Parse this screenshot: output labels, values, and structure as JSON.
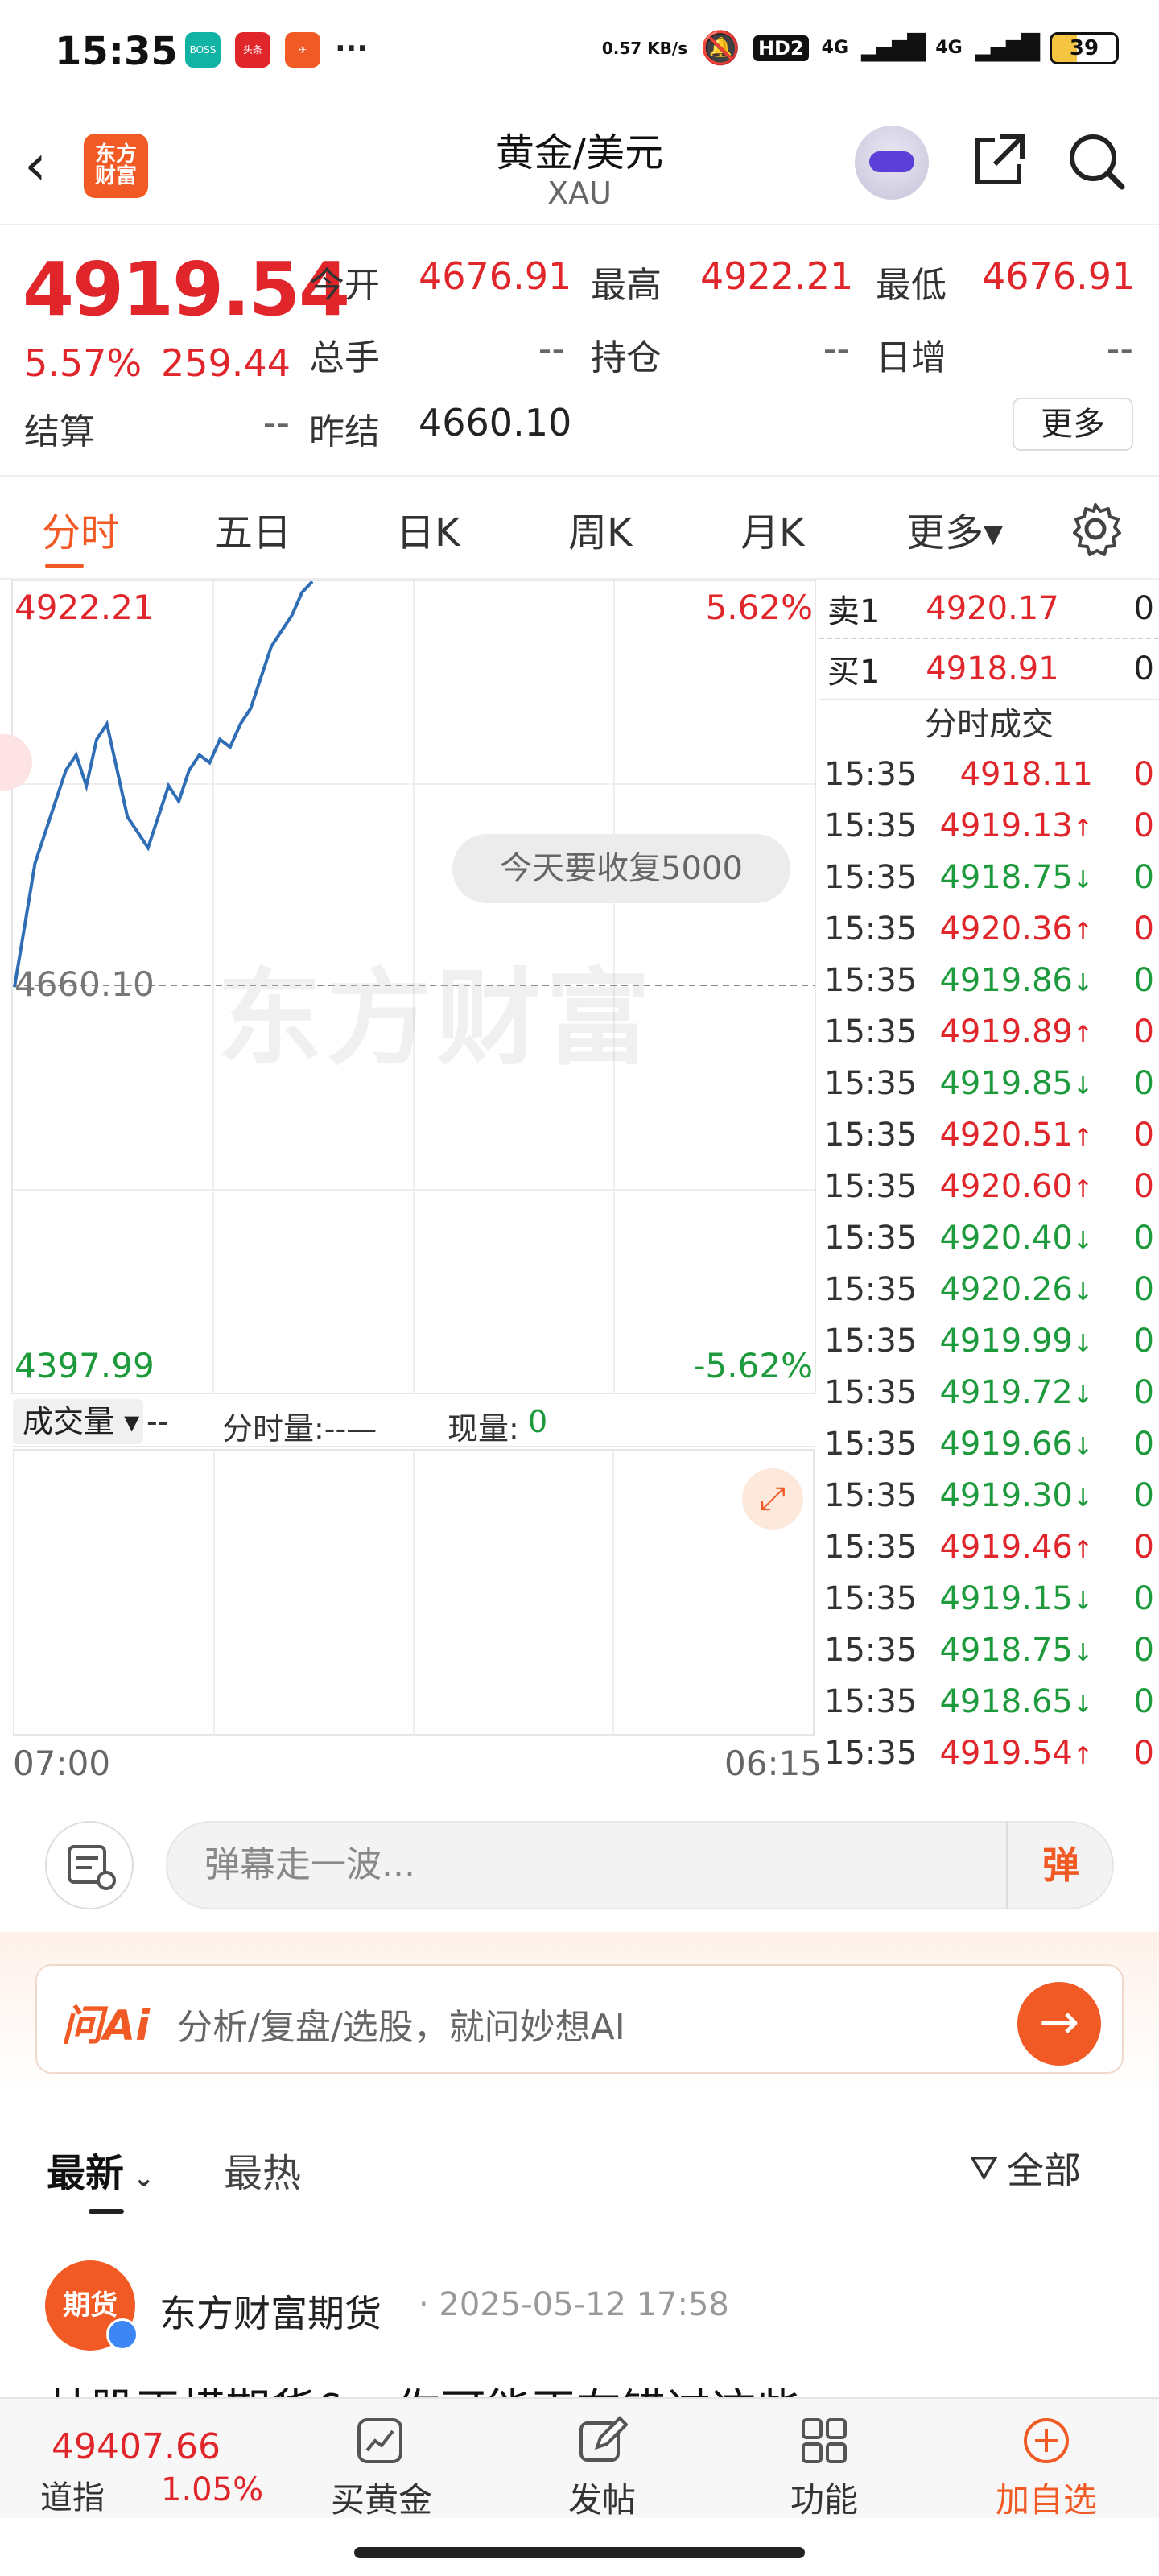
{
  "status_bar": {
    "time": "15:35",
    "apps": [
      "BOSS直聘",
      "头条",
      "消息"
    ],
    "more": "···",
    "net_speed": "0.57 KB/s",
    "hd": "HD2",
    "sig1": "4G",
    "sig2": "4G",
    "battery": "39"
  },
  "header": {
    "logo": "东方\n财富",
    "title": "黄金/美元",
    "subtitle": "XAU"
  },
  "quote": {
    "price": "4919.54",
    "change_pct": "5.57%",
    "change_val": "259.44",
    "open_label": "今开",
    "open": "4676.91",
    "high_label": "最高",
    "high": "4922.21",
    "low_label": "最低",
    "low": "4676.91",
    "volume_label": "总手",
    "volume": "--",
    "oi_label": "持仓",
    "oi": "--",
    "daily_inc_label": "日增",
    "daily_inc": "--",
    "settle_label": "结算",
    "settle": "--",
    "prev_settle_label": "昨结",
    "prev_settle": "4660.10",
    "more": "更多"
  },
  "tabs": [
    "分时",
    "五日",
    "日K",
    "周K",
    "月K",
    "更多▾"
  ],
  "chart": {
    "top_price": "4922.21",
    "top_pct": "5.62%",
    "mid_price": "4660.10",
    "bottom_price": "4397.99",
    "bottom_pct": "-5.62%",
    "bubble": "今天要收复5000",
    "watermark": "东方财富",
    "vol_label": "成交量 ▾",
    "vol_dash": "--",
    "intraday_vol": "分时量:--—",
    "now_vol_label": "现量:",
    "now_vol": "0",
    "start_time": "07:00",
    "end_time": "06:15"
  },
  "chart_data": {
    "type": "line",
    "series": [
      {
        "values": [
          4660,
          4700,
          4740,
          4760,
          4780,
          4800,
          4810,
          4790,
          4820,
          4830,
          4800,
          4770,
          4760,
          4750,
          4770,
          4790,
          4780,
          4800,
          4810,
          4805,
          4820,
          4815,
          4830,
          4840,
          4860,
          4880,
          4890,
          4900,
          4915,
          4922
        ]
      }
    ],
    "ylim": [
      4397.99,
      4922.21
    ],
    "prev_close": 4660.1
  },
  "orderbook": {
    "sell1_label": "卖1",
    "sell1_price": "4920.17",
    "sell1_vol": "0",
    "buy1_label": "买1",
    "buy1_price": "4918.91",
    "buy1_vol": "0",
    "trades_title": "分时成交"
  },
  "trades": [
    {
      "t": "15:35",
      "p": "4918.11",
      "a": "",
      "v": "0",
      "c": "red"
    },
    {
      "t": "15:35",
      "p": "4919.13",
      "a": "↑",
      "v": "0",
      "c": "red"
    },
    {
      "t": "15:35",
      "p": "4918.75",
      "a": "↓",
      "v": "0",
      "c": "green"
    },
    {
      "t": "15:35",
      "p": "4920.36",
      "a": "↑",
      "v": "0",
      "c": "red"
    },
    {
      "t": "15:35",
      "p": "4919.86",
      "a": "↓",
      "v": "0",
      "c": "green"
    },
    {
      "t": "15:35",
      "p": "4919.89",
      "a": "↑",
      "v": "0",
      "c": "red"
    },
    {
      "t": "15:35",
      "p": "4919.85",
      "a": "↓",
      "v": "0",
      "c": "green"
    },
    {
      "t": "15:35",
      "p": "4920.51",
      "a": "↑",
      "v": "0",
      "c": "red"
    },
    {
      "t": "15:35",
      "p": "4920.60",
      "a": "↑",
      "v": "0",
      "c": "red"
    },
    {
      "t": "15:35",
      "p": "4920.40",
      "a": "↓",
      "v": "0",
      "c": "green"
    },
    {
      "t": "15:35",
      "p": "4920.26",
      "a": "↓",
      "v": "0",
      "c": "green"
    },
    {
      "t": "15:35",
      "p": "4919.99",
      "a": "↓",
      "v": "0",
      "c": "green"
    },
    {
      "t": "15:35",
      "p": "4919.72",
      "a": "↓",
      "v": "0",
      "c": "green"
    },
    {
      "t": "15:35",
      "p": "4919.66",
      "a": "↓",
      "v": "0",
      "c": "green"
    },
    {
      "t": "15:35",
      "p": "4919.30",
      "a": "↓",
      "v": "0",
      "c": "green"
    },
    {
      "t": "15:35",
      "p": "4919.46",
      "a": "↑",
      "v": "0",
      "c": "red"
    },
    {
      "t": "15:35",
      "p": "4919.15",
      "a": "↓",
      "v": "0",
      "c": "green"
    },
    {
      "t": "15:35",
      "p": "4918.75",
      "a": "↓",
      "v": "0",
      "c": "green"
    },
    {
      "t": "15:35",
      "p": "4918.65",
      "a": "↓",
      "v": "0",
      "c": "green"
    },
    {
      "t": "15:35",
      "p": "4919.54",
      "a": "↑",
      "v": "0",
      "c": "red"
    }
  ],
  "danmu": {
    "placeholder": "弹幕走一波...",
    "button": "弹"
  },
  "ai": {
    "logo": "问Ai",
    "placeholder": "分析/复盘/选股，就问妙想AI",
    "go": "→"
  },
  "feed": {
    "tab_latest": "最新",
    "tab_hot": "最热",
    "filter": "全部",
    "post": {
      "avatar": "期货",
      "author": "东方财富期货",
      "date": "· 2025-05-12 17:58",
      "title_cut": "林股正横期货&，你可能正在错过这些"
    }
  },
  "bottom_nav": {
    "index_value": "49407.66",
    "index_name": "道指",
    "index_pct": "1.05%",
    "buy_gold": "买黄金",
    "post": "发帖",
    "func": "功能",
    "add_fav": "加自选"
  },
  "colors": {
    "accent": "#f15a24",
    "up": "#e0262b",
    "down": "#1d9a3b",
    "line": "#2f6db5"
  }
}
